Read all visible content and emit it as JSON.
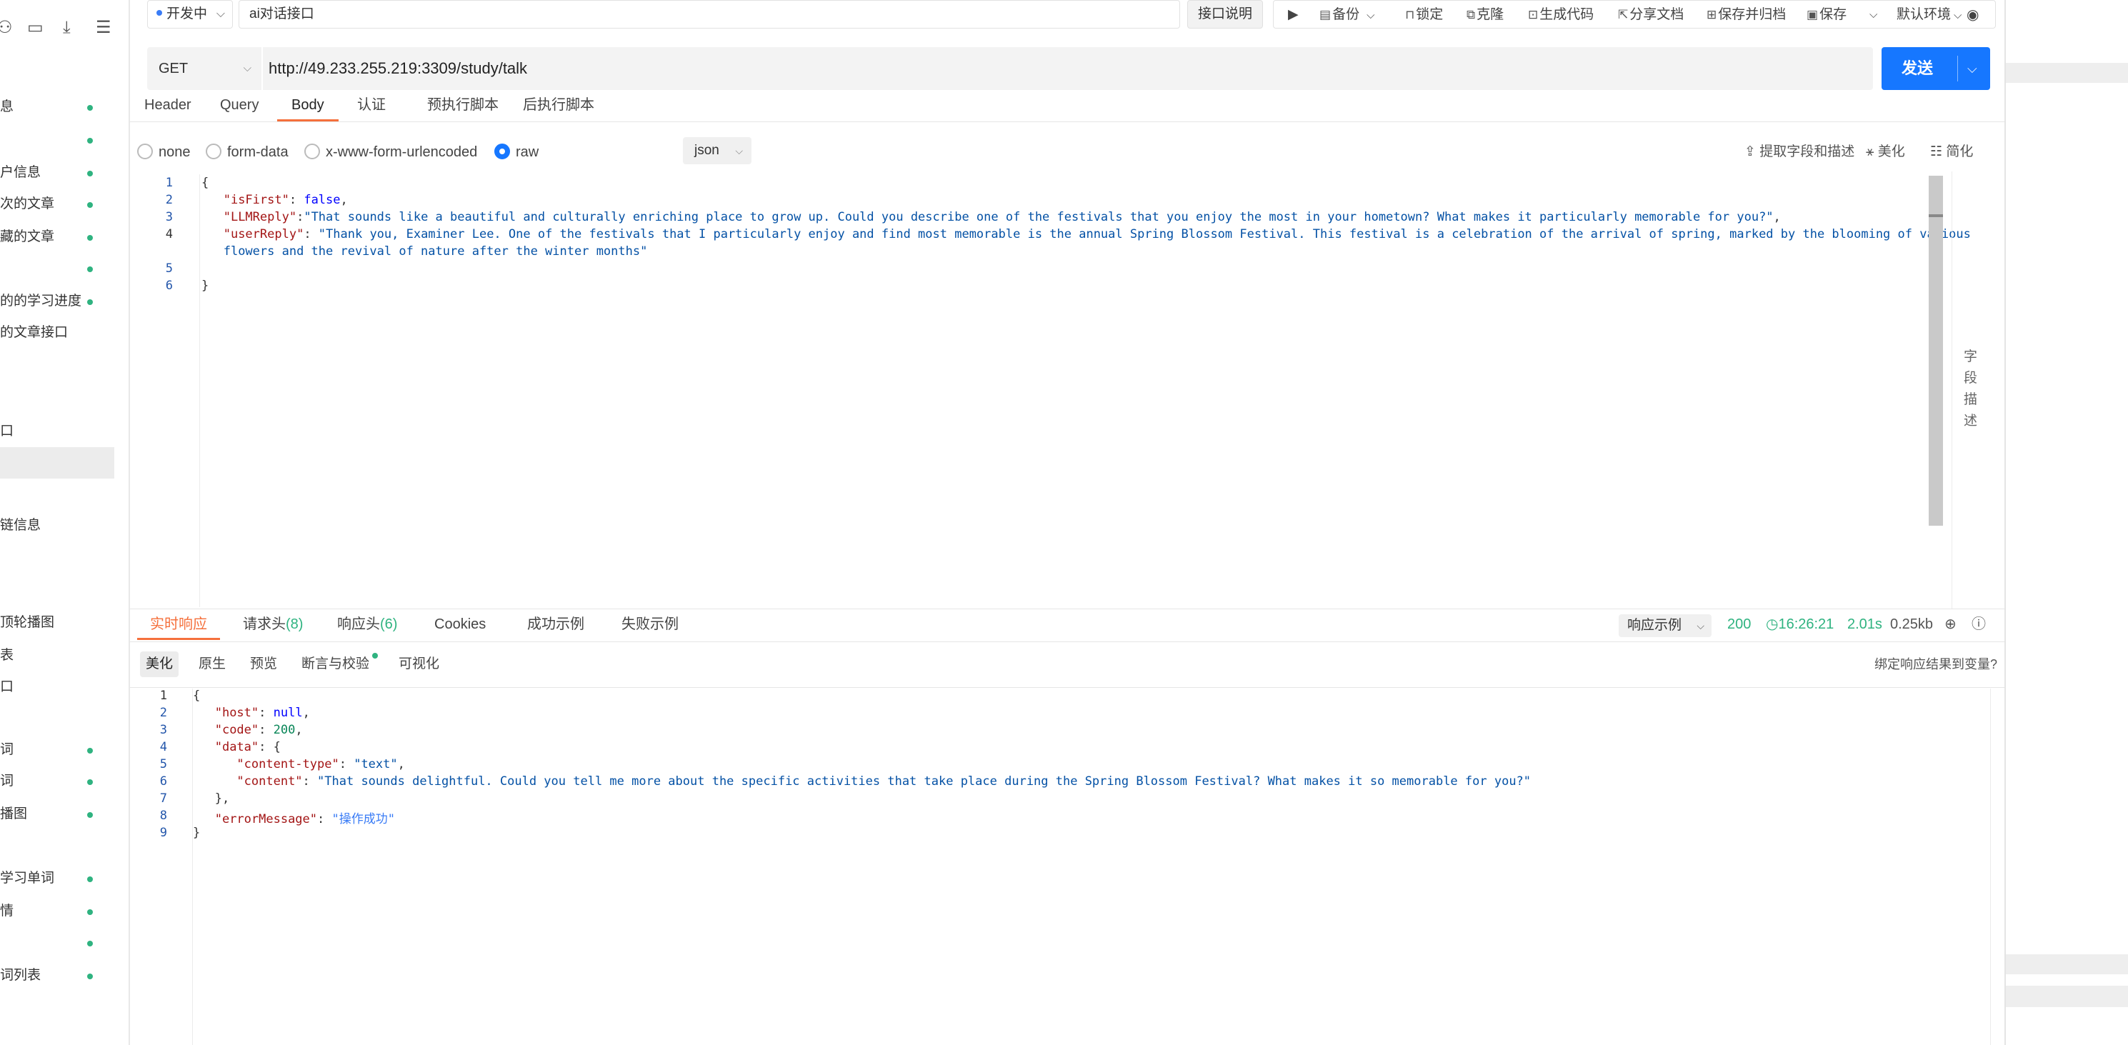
{
  "sidebar": {
    "items": [
      {
        "label": "息",
        "dot": true
      },
      {
        "label": "",
        "dot": true
      },
      {
        "label": "户信息",
        "dot": true
      },
      {
        "label": "次的文章",
        "dot": true
      },
      {
        "label": "藏的文章",
        "dot": true
      },
      {
        "label": "",
        "dot": true
      },
      {
        "label": "的的学习进度",
        "dot": true
      },
      {
        "label": "的文章接口",
        "dot": false
      },
      {
        "label": "口",
        "dot": false
      },
      {
        "label": "",
        "dot": false,
        "selected": true
      },
      {
        "label": "链信息",
        "dot": false
      },
      {
        "label": "顶轮播图",
        "dot": false
      },
      {
        "label": "表",
        "dot": false
      },
      {
        "label": "口",
        "dot": false
      },
      {
        "label": "词",
        "dot": true
      },
      {
        "label": "词",
        "dot": true
      },
      {
        "label": "播图",
        "dot": true
      },
      {
        "label": "学习单词",
        "dot": true
      },
      {
        "label": "情",
        "dot": true
      },
      {
        "label": "",
        "dot": true
      },
      {
        "label": "词列表",
        "dot": true
      }
    ]
  },
  "toolbar": {
    "status": "开发中",
    "api_name": "ai对话接口",
    "doc_button": "接口说明",
    "backup": "备份",
    "lock": "锁定",
    "clone": "克隆",
    "gen_code": "生成代码",
    "share_doc": "分享文档",
    "save_archive": "保存并归档",
    "save": "保存",
    "env": "默认环境"
  },
  "request": {
    "method": "GET",
    "url": "http://49.233.255.219:3309/study/talk",
    "send": "发送",
    "tabs": [
      "Header",
      "Query",
      "Body",
      "认证",
      "预执行脚本",
      "后执行脚本"
    ],
    "active_tab": "Body",
    "body_types": [
      "none",
      "form-data",
      "x-www-form-urlencoded",
      "raw"
    ],
    "selected_body_type": "raw",
    "format": "json",
    "tools": {
      "extract": "提取字段和描述",
      "beautify": "美化",
      "simplify": "简化"
    },
    "field_desc": [
      "字",
      "段",
      "描",
      "述"
    ],
    "body": {
      "isFirst": "false",
      "LLMReply": "\"That sounds like a beautiful and culturally enriching place to grow up. Could you describe one of the festivals that you enjoy the most in your hometown? What makes it particularly memorable for you?\"",
      "userReply_1": "\"Thank you, Examiner Lee. One of the festivals that I particularly enjoy and find most memorable is the annual Spring Blossom Festival. This festival is a celebration of the arrival of spring, marked by the blooming of various",
      "userReply_2": "flowers and the revival of nature after the winter months\""
    },
    "line_numbers": [
      "1",
      "2",
      "3",
      "4",
      "",
      "5",
      "6"
    ]
  },
  "response": {
    "tabs": [
      {
        "label": "实时响应"
      },
      {
        "label": "请求头",
        "count": "(8)"
      },
      {
        "label": "响应头",
        "count": "(6)"
      },
      {
        "label": "Cookies"
      },
      {
        "label": "成功示例"
      },
      {
        "label": "失败示例"
      }
    ],
    "example_select": "响应示例",
    "status_code": "200",
    "time": "16:26:21",
    "duration": "2.01s",
    "size": "0.25kb",
    "subtabs": [
      "美化",
      "原生",
      "预览",
      "断言与校验",
      "可视化"
    ],
    "bind_link": "绑定响应结果到变量?",
    "body": {
      "host": "null",
      "code": "200",
      "content_type": "\"text\"",
      "content": "\"That sounds delightful. Could you tell me more about the specific activities that take place during the Spring Blossom Festival? What makes it so memorable for you?\"",
      "errorMessage": "\"操作成功\""
    },
    "line_numbers": [
      "1",
      "2",
      "3",
      "4",
      "5",
      "6",
      "7",
      "8",
      "9"
    ]
  },
  "colors": {
    "accent": "#1677ff",
    "tab_active": "#f5703c",
    "success": "#2fb380"
  }
}
